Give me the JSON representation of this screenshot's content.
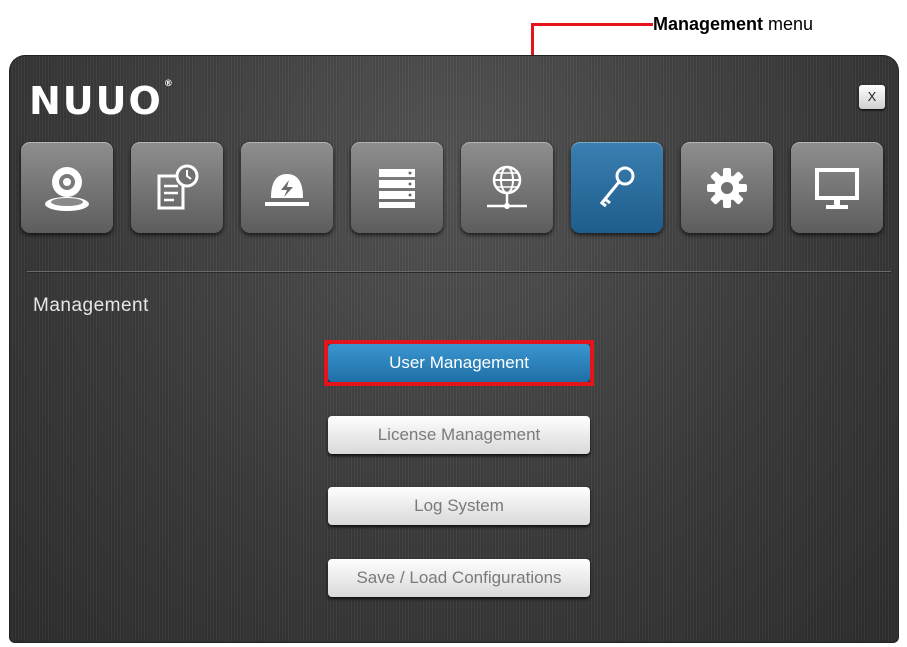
{
  "annotation": {
    "label_bold": "Management",
    "label_rest": " menu"
  },
  "window": {
    "logo": "NUUO",
    "logo_mark": "®",
    "close_label": "X"
  },
  "toolbar": {
    "tiles": [
      {
        "icon": "camera-icon",
        "active": false
      },
      {
        "icon": "schedule-icon",
        "active": false
      },
      {
        "icon": "event-alarm-icon",
        "active": false
      },
      {
        "icon": "storage-icon",
        "active": false
      },
      {
        "icon": "network-icon",
        "active": false
      },
      {
        "icon": "key-icon",
        "active": true
      },
      {
        "icon": "gear-icon",
        "active": false
      },
      {
        "icon": "monitor-icon",
        "active": false
      }
    ]
  },
  "section": {
    "title": "Management"
  },
  "menu": {
    "user_management": "User Management",
    "license_management": "License Management",
    "log_system": "Log System",
    "save_load": "Save / Load Configurations"
  },
  "colors": {
    "accent_blue": "#2a82bd",
    "highlight_red": "#e3141b",
    "window_bg": "#3d3d3d"
  }
}
